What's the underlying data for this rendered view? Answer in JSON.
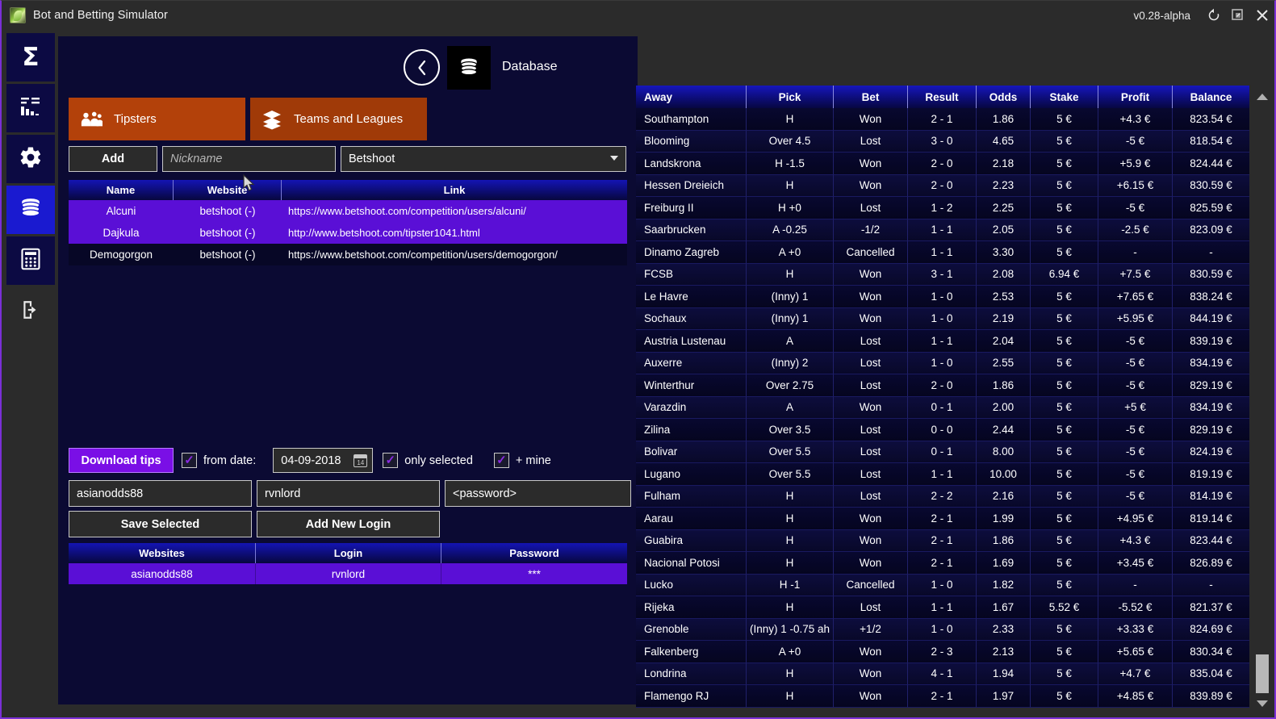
{
  "window": {
    "title": "Bot and Betting Simulator",
    "app_icon": "leaf-icon",
    "version": "v0.28-alpha",
    "buttons": {
      "refresh": "refresh-icon",
      "restore": "restore-icon",
      "close": "close-icon"
    }
  },
  "sidebar": {
    "items": [
      {
        "name": "sidebar-item-summary",
        "icon": "sigma-icon",
        "glyph": "Σ",
        "active": false
      },
      {
        "name": "sidebar-item-statistics",
        "icon": "bar-chart-icon",
        "glyph": "",
        "active": false
      },
      {
        "name": "sidebar-item-settings",
        "icon": "gear-icon",
        "glyph": "",
        "active": false
      },
      {
        "name": "sidebar-item-database",
        "icon": "database-icon",
        "glyph": "",
        "active": true
      },
      {
        "name": "sidebar-item-calculator",
        "icon": "calculator-icon",
        "glyph": "",
        "active": false
      },
      {
        "name": "sidebar-item-logout",
        "icon": "logout-icon",
        "glyph": "",
        "active": false
      }
    ]
  },
  "panel": {
    "back_label": "‹",
    "section_icon": "database-icon",
    "section_title": "Database",
    "tabs": [
      {
        "label": "Tipsters",
        "icon": "people-icon"
      },
      {
        "label": "Teams and Leagues",
        "icon": "layers-icon"
      }
    ],
    "add_button": "Add",
    "nickname_placeholder": "Nickname",
    "nickname_value": "",
    "site_select_value": "Betshoot",
    "site_select_options": [
      "Betshoot"
    ]
  },
  "tipsters_grid": {
    "columns": [
      "Name",
      "Website",
      "Link"
    ],
    "rows": [
      {
        "name": "Alcuni",
        "website": "betshoot (-)",
        "link": "https://www.betshoot.com/competition/users/alcuni/",
        "selected": true
      },
      {
        "name": "Dajkula",
        "website": "betshoot (-)",
        "link": "http://www.betshoot.com/tipster1041.html",
        "selected": true
      },
      {
        "name": "Demogorgon",
        "website": "betshoot (-)",
        "link": "https://www.betshoot.com/competition/users/demogorgon/",
        "selected": false
      }
    ]
  },
  "download": {
    "button_label": "Download tips",
    "from_date_checked": true,
    "from_date_label": "from date:",
    "date_value": "04-09-2018",
    "calendar_icon": "calendar-icon",
    "only_selected_checked": true,
    "only_selected_label": "only selected",
    "plus_mine_checked": true,
    "plus_mine_label": "+ mine",
    "check_glyph": "✓"
  },
  "credentials": {
    "site_value": "asianodds88",
    "login_value": "rvnlord",
    "password_value": "<password>",
    "save_selected_label": "Save Selected",
    "add_new_login_label": "Add New Login"
  },
  "websites_grid": {
    "columns": [
      "Websites",
      "Login",
      "Password"
    ],
    "rows": [
      {
        "website": "asianodds88",
        "login": "rvnlord",
        "password": "***",
        "selected": true
      }
    ]
  },
  "bets_table": {
    "columns": [
      "Away",
      "Pick",
      "Bet",
      "Result",
      "Odds",
      "Stake",
      "Profit",
      "Balance"
    ],
    "rows": [
      {
        "away": "Southampton",
        "pick": "H",
        "bet": "Won",
        "result": "2 - 1",
        "odds": "1.86",
        "stake": "5 €",
        "profit": "+4.3 €",
        "balance": "823.54 €"
      },
      {
        "away": "Blooming",
        "pick": "Over 4.5",
        "bet": "Lost",
        "result": "3 - 0",
        "odds": "4.65",
        "stake": "5 €",
        "profit": "-5 €",
        "balance": "818.54 €"
      },
      {
        "away": "Landskrona",
        "pick": "H -1.5",
        "bet": "Won",
        "result": "2 - 0",
        "odds": "2.18",
        "stake": "5 €",
        "profit": "+5.9 €",
        "balance": "824.44 €"
      },
      {
        "away": "Hessen Dreieich",
        "pick": "H",
        "bet": "Won",
        "result": "2 - 0",
        "odds": "2.23",
        "stake": "5 €",
        "profit": "+6.15 €",
        "balance": "830.59 €"
      },
      {
        "away": "Freiburg II",
        "pick": "H +0",
        "bet": "Lost",
        "result": "1 - 2",
        "odds": "2.25",
        "stake": "5 €",
        "profit": "-5 €",
        "balance": "825.59 €"
      },
      {
        "away": "Saarbrucken",
        "pick": "A -0.25",
        "bet": "-1/2",
        "result": "1 - 1",
        "odds": "2.05",
        "stake": "5 €",
        "profit": "-2.5 €",
        "balance": "823.09 €"
      },
      {
        "away": "Dinamo Zagreb",
        "pick": "A +0",
        "bet": "Cancelled",
        "result": "1 - 1",
        "odds": "3.30",
        "stake": "5 €",
        "profit": "-",
        "balance": "-"
      },
      {
        "away": "FCSB",
        "pick": "H",
        "bet": "Won",
        "result": "3 - 1",
        "odds": "2.08",
        "stake": "6.94 €",
        "profit": "+7.5 €",
        "balance": "830.59 €"
      },
      {
        "away": "Le Havre",
        "pick": "(Inny) 1",
        "bet": "Won",
        "result": "1 - 0",
        "odds": "2.53",
        "stake": "5 €",
        "profit": "+7.65 €",
        "balance": "838.24 €"
      },
      {
        "away": "Sochaux",
        "pick": "(Inny) 1",
        "bet": "Won",
        "result": "1 - 0",
        "odds": "2.19",
        "stake": "5 €",
        "profit": "+5.95 €",
        "balance": "844.19 €"
      },
      {
        "away": "Austria Lustenau",
        "pick": "A",
        "bet": "Lost",
        "result": "1 - 1",
        "odds": "2.04",
        "stake": "5 €",
        "profit": "-5 €",
        "balance": "839.19 €"
      },
      {
        "away": "Auxerre",
        "pick": "(Inny) 2",
        "bet": "Lost",
        "result": "1 - 0",
        "odds": "2.55",
        "stake": "5 €",
        "profit": "-5 €",
        "balance": "834.19 €"
      },
      {
        "away": "Winterthur",
        "pick": "Over 2.75",
        "bet": "Lost",
        "result": "2 - 0",
        "odds": "1.86",
        "stake": "5 €",
        "profit": "-5 €",
        "balance": "829.19 €"
      },
      {
        "away": "Varazdin",
        "pick": "A",
        "bet": "Won",
        "result": "0 - 1",
        "odds": "2.00",
        "stake": "5 €",
        "profit": "+5 €",
        "balance": "834.19 €"
      },
      {
        "away": "Zilina",
        "pick": "Over 3.5",
        "bet": "Lost",
        "result": "0 - 0",
        "odds": "2.44",
        "stake": "5 €",
        "profit": "-5 €",
        "balance": "829.19 €"
      },
      {
        "away": "Bolivar",
        "pick": "Over 5.5",
        "bet": "Lost",
        "result": "0 - 1",
        "odds": "8.00",
        "stake": "5 €",
        "profit": "-5 €",
        "balance": "824.19 €"
      },
      {
        "away": "Lugano",
        "pick": "Over 5.5",
        "bet": "Lost",
        "result": "1 - 1",
        "odds": "10.00",
        "stake": "5 €",
        "profit": "-5 €",
        "balance": "819.19 €"
      },
      {
        "away": "Fulham",
        "pick": "H",
        "bet": "Lost",
        "result": "2 - 2",
        "odds": "2.16",
        "stake": "5 €",
        "profit": "-5 €",
        "balance": "814.19 €"
      },
      {
        "away": "Aarau",
        "pick": "H",
        "bet": "Won",
        "result": "2 - 1",
        "odds": "1.99",
        "stake": "5 €",
        "profit": "+4.95 €",
        "balance": "819.14 €"
      },
      {
        "away": "Guabira",
        "pick": "H",
        "bet": "Won",
        "result": "2 - 1",
        "odds": "1.86",
        "stake": "5 €",
        "profit": "+4.3 €",
        "balance": "823.44 €"
      },
      {
        "away": "Nacional Potosi",
        "pick": "H",
        "bet": "Won",
        "result": "2 - 1",
        "odds": "1.69",
        "stake": "5 €",
        "profit": "+3.45 €",
        "balance": "826.89 €"
      },
      {
        "away": "Lucko",
        "pick": "H -1",
        "bet": "Cancelled",
        "result": "1 - 0",
        "odds": "1.82",
        "stake": "5 €",
        "profit": "-",
        "balance": "-"
      },
      {
        "away": "Rijeka",
        "pick": "H",
        "bet": "Lost",
        "result": "1 - 1",
        "odds": "1.67",
        "stake": "5.52 €",
        "profit": "-5.52 €",
        "balance": "821.37 €"
      },
      {
        "away": "Grenoble",
        "pick": "(Inny) 1 -0.75 ah",
        "bet": "+1/2",
        "result": "1 - 0",
        "odds": "2.33",
        "stake": "5 €",
        "profit": "+3.33 €",
        "balance": "824.69 €"
      },
      {
        "away": "Falkenberg",
        "pick": "A +0",
        "bet": "Won",
        "result": "2 - 3",
        "odds": "2.13",
        "stake": "5 €",
        "profit": "+5.65 €",
        "balance": "830.34 €"
      },
      {
        "away": "Londrina",
        "pick": "H",
        "bet": "Won",
        "result": "4 - 1",
        "odds": "1.94",
        "stake": "5 €",
        "profit": "+4.7 €",
        "balance": "835.04 €"
      },
      {
        "away": "Flamengo RJ",
        "pick": "H",
        "bet": "Won",
        "result": "2 - 1",
        "odds": "1.97",
        "stake": "5 €",
        "profit": "+4.85 €",
        "balance": "839.89 €"
      }
    ]
  },
  "scrollbar": {
    "up_arrow": "triangle-up-icon",
    "down_arrow": "triangle-down-icon"
  },
  "colors": {
    "accent_purple": "#7a0fe6",
    "tab_orange": "#b3410a",
    "panel_bg": "#0b0a33",
    "rail_active": "#1a1ad0",
    "window_border": "#7a2fd6"
  }
}
